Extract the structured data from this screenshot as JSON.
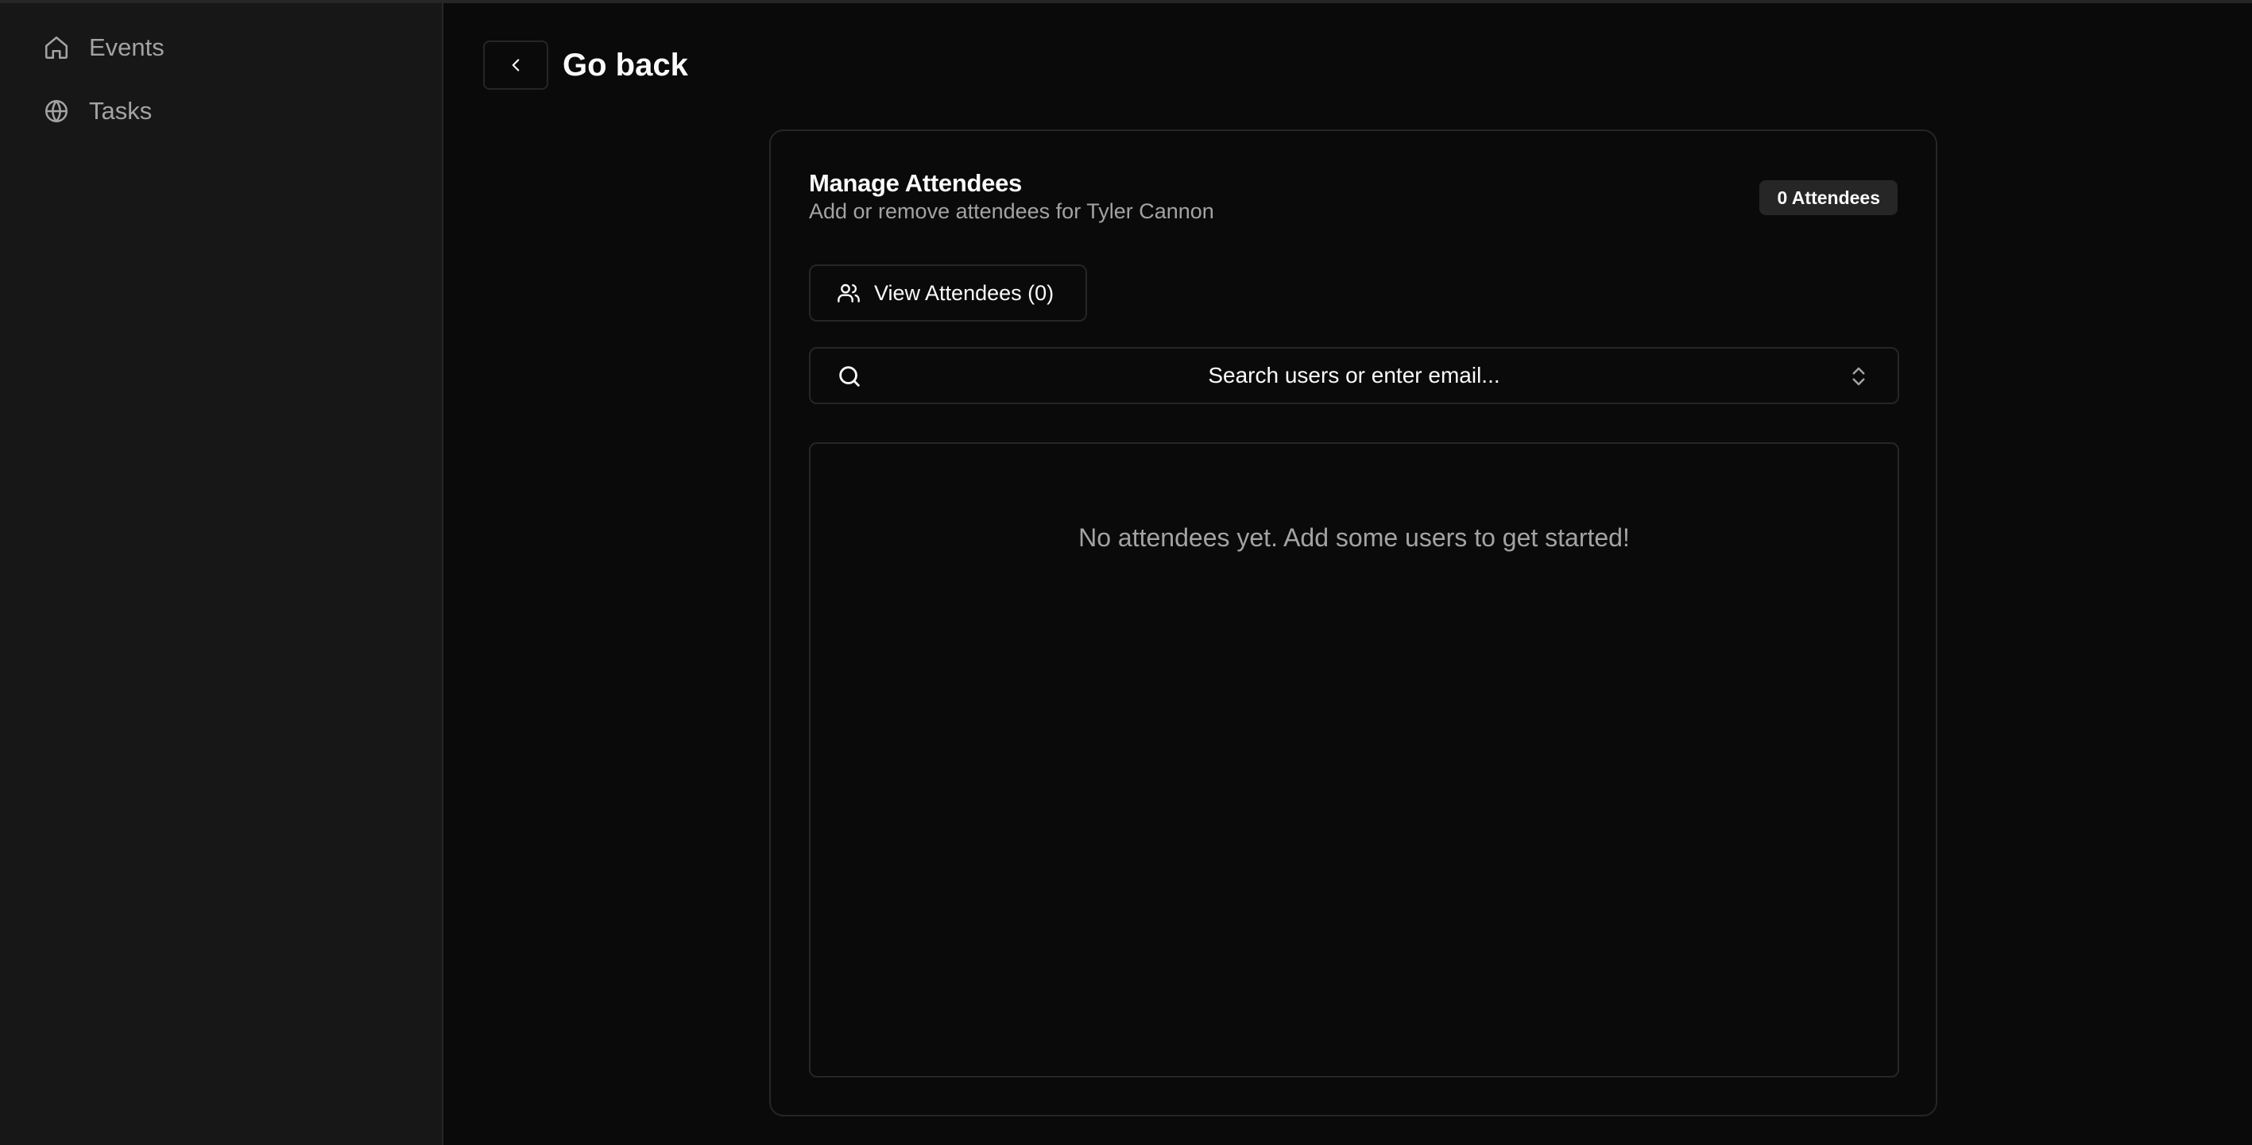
{
  "sidebar": {
    "items": [
      {
        "label": "Events",
        "icon": "home-icon"
      },
      {
        "label": "Tasks",
        "icon": "globe-icon"
      }
    ]
  },
  "header": {
    "back_label": "Go back"
  },
  "card": {
    "title": "Manage Attendees",
    "subtitle": "Add or remove attendees for Tyler Cannon",
    "badge": "0 Attendees",
    "view_button_label": "View Attendees (0)",
    "search_placeholder": "Search users or enter email...",
    "empty_message": "No attendees yet. Add some users to get started!"
  },
  "colors": {
    "background": "#0a0a0a",
    "sidebar": "#171717",
    "border": "#262626",
    "text_primary": "#fafafa",
    "text_muted": "#a3a3a3"
  }
}
